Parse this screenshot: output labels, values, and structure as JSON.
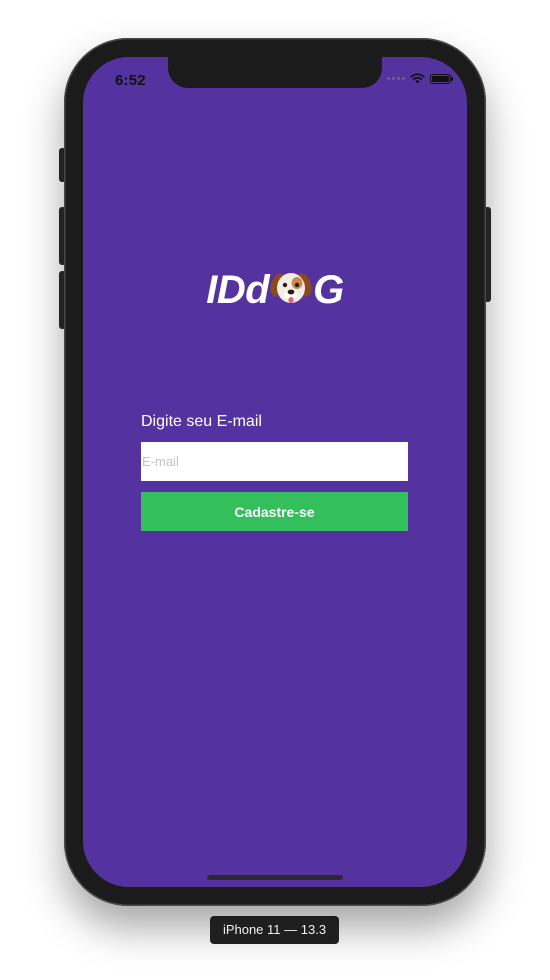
{
  "status_bar": {
    "time": "6:52"
  },
  "app": {
    "logo_prefix": "IDd",
    "logo_suffix": "G",
    "logo_icon": "dog-face-icon",
    "email_label": "Digite seu E-mail",
    "email_placeholder": "E-mail",
    "email_value": "",
    "signup_label": "Cadastre-se"
  },
  "simulator": {
    "device_label": "iPhone 11 — 13.3"
  },
  "colors": {
    "background": "#5433a0",
    "button": "#33bf5b",
    "text": "#ffffff"
  }
}
